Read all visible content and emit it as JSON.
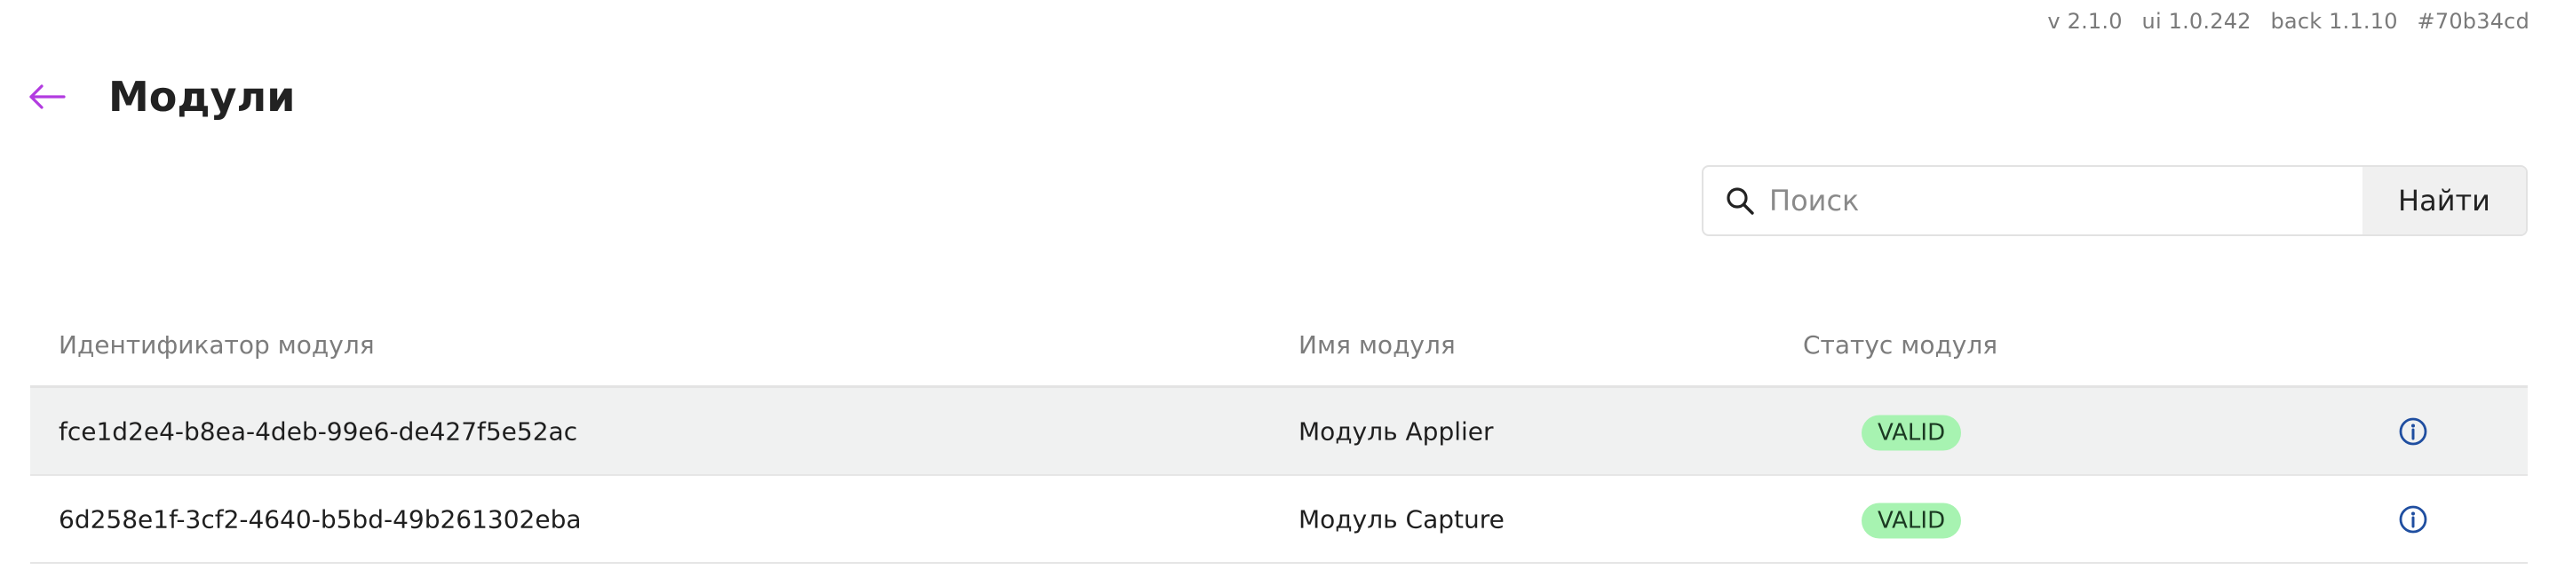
{
  "version": {
    "app": "v 2.1.0",
    "ui": "ui 1.0.242",
    "back": "back 1.1.10",
    "hash": "#70b34cd"
  },
  "header": {
    "title": "Модули",
    "back_icon": "arrow-left-icon",
    "back_icon_color": "#b23be0"
  },
  "search": {
    "placeholder": "Поиск",
    "value": "",
    "button_label": "Найти",
    "icon": "search-icon"
  },
  "table": {
    "columns": [
      "Идентификатор модуля",
      "Имя модуля",
      "Статус модуля"
    ],
    "rows": [
      {
        "id": "fce1d2e4-b8ea-4deb-99e6-de427f5e52ac",
        "name": "Модуль Applier",
        "status": "VALID",
        "action_icon": "info-icon"
      },
      {
        "id": "6d258e1f-3cf2-4640-b5bd-49b261302eba",
        "name": "Модуль Capture",
        "status": "VALID",
        "action_icon": "info-icon"
      }
    ]
  },
  "colors": {
    "status_valid_bg": "#a7f3b1",
    "info_icon": "#1f4ea0",
    "row_highlight": "#f0f1f1"
  }
}
